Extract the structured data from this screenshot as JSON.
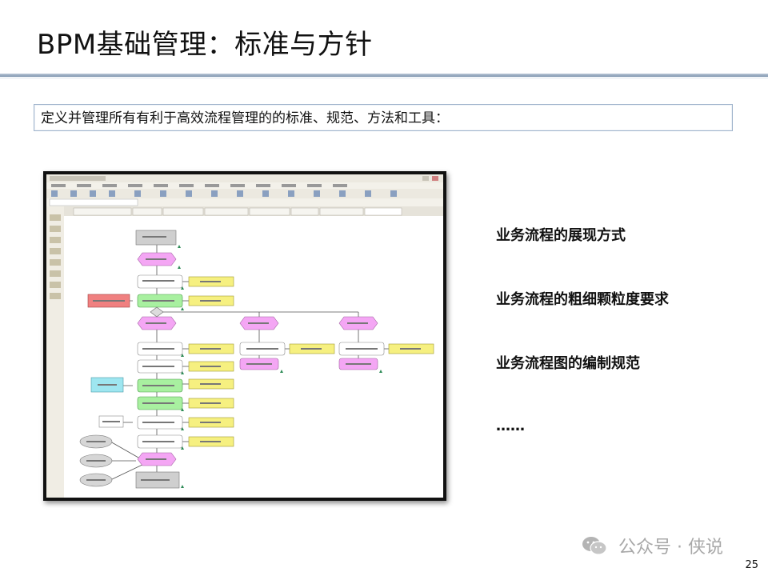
{
  "slide": {
    "title": "BPM基础管理：标准与方针",
    "intro": "定义并管理所有有利于高效流程管理的的标准、规范、方法和工具：",
    "bullets": [
      "业务流程的展现方式",
      "业务流程的粗细颗粒度要求",
      "业务流程图的编制规范",
      "……"
    ],
    "page_number": "25"
  },
  "watermark": {
    "text": "公众号 · 侠说",
    "icon": "wechat-icon"
  },
  "screenshot": {
    "description_icon": "aris-architect-screenshot",
    "colors": {
      "event": "#f4a6f4",
      "function": "#ffffff",
      "function_green": "#a8f0a0",
      "doc": "#f6f080",
      "red": "#f08080",
      "cyan": "#9ee6f0",
      "toolbar": "#ece9e0"
    }
  }
}
